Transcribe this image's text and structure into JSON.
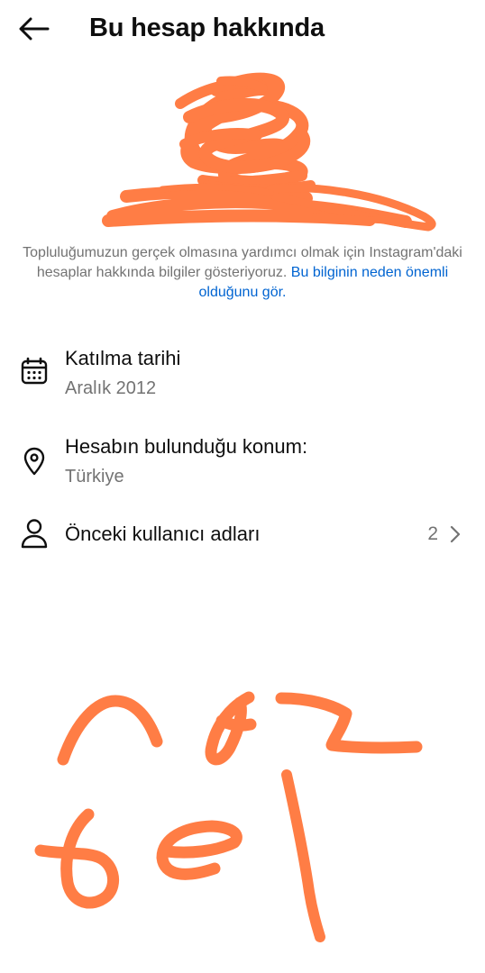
{
  "header": {
    "title": "Bu hesap hakkında",
    "back_icon": "arrow-left-icon"
  },
  "info": {
    "text": "Topluluğumuzun gerçek olmasına yardımcı olmak için Instagram'daki hesaplar hakkında bilgiler gösteriyoruz. ",
    "link": "Bu bilginin neden önemli olduğunu gör."
  },
  "details": {
    "join_date": {
      "icon": "calendar-icon",
      "label": "Katılma tarihi",
      "value": "Aralık 2012"
    },
    "location": {
      "icon": "location-pin-icon",
      "label": "Hesabın bulunduğu konum:",
      "value": "Türkiye"
    },
    "former_usernames": {
      "icon": "person-icon",
      "label": "Önceki kullanıcı adları",
      "count": "2",
      "chevron_icon": "chevron-right-icon"
    }
  },
  "colors": {
    "link": "#0064d1",
    "secondary_text": "#737373",
    "primary_text": "#0f0f0f",
    "redaction_scribble": "#ff7d45"
  }
}
